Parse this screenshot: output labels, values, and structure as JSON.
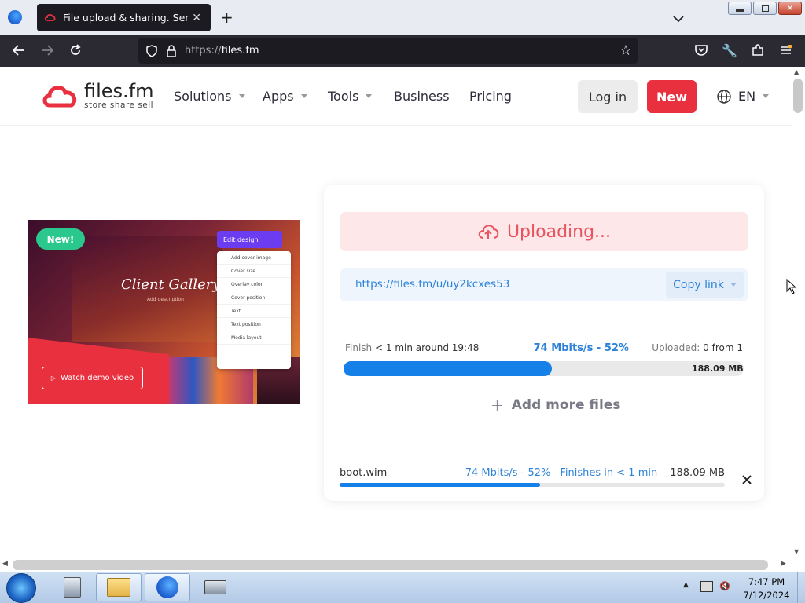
{
  "browser": {
    "tab_title": "File upload & sharing. Send large",
    "url_prefix": "https://",
    "url_domain": "files.fm",
    "address": "https://files.fm"
  },
  "site": {
    "logo_name": "files.fm",
    "logo_tagline": "store share sell",
    "nav": [
      "Solutions",
      "Apps",
      "Tools",
      "Business",
      "Pricing"
    ],
    "login_label": "Log in",
    "new_label": "New",
    "language": "EN",
    "brand_color": "#e8303f"
  },
  "promo": {
    "badge": "New!",
    "edit_design": "Edit design",
    "gallery_title": "Client Gallery",
    "gallery_sub": "Add description",
    "menu_items": [
      "Add cover image",
      "Cover size",
      "Overlay color",
      "Cover position",
      "Text",
      "Text position",
      "Media layout"
    ],
    "watch_demo": "Watch demo video"
  },
  "upload": {
    "status": "Uploading...",
    "link": "https://files.fm/u/uy2kcxes53",
    "copy_link": "Copy link",
    "finish_label": "Finish",
    "finish_value": "< 1 min around 19:48",
    "speed": "74 Mbits/s - 52%",
    "uploaded_label": "Uploaded:",
    "uploaded_value": "0 from 1",
    "total_size": "188.09 MB",
    "progress_fraction": 0.52,
    "add_more": "Add more files",
    "file": {
      "name": "boot.wim",
      "speed": "74 Mbits/s - 52%",
      "finishes": "Finishes in < 1 min",
      "size": "188.09 MB",
      "progress_fraction": 0.52
    }
  },
  "taskbar": {
    "time": "7:47 PM",
    "date": "7/12/2024"
  }
}
